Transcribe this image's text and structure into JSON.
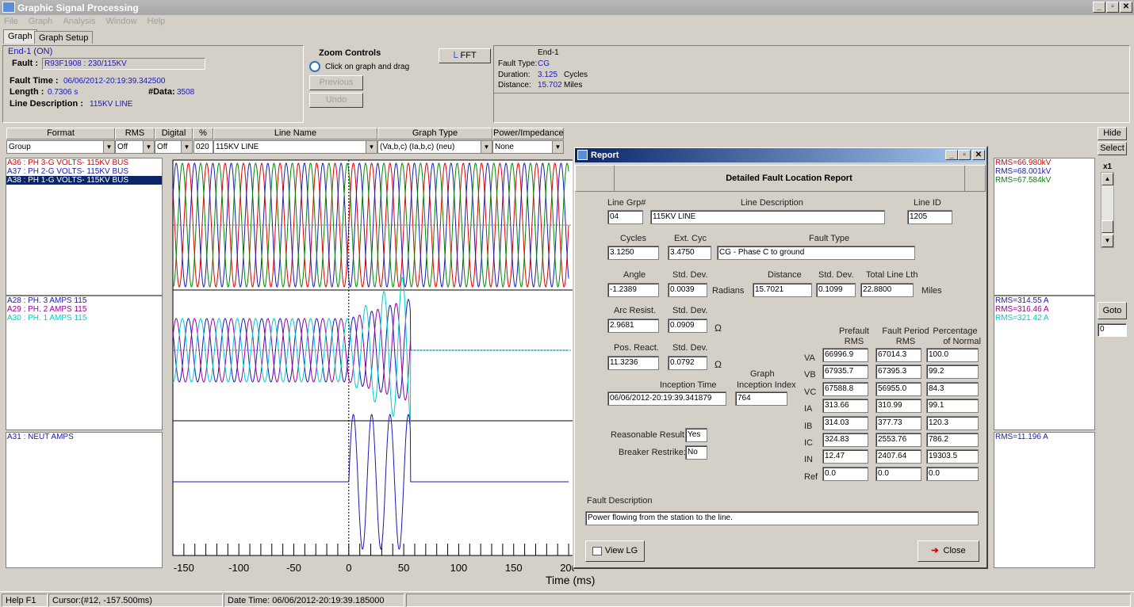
{
  "app": {
    "title": "Graphic Signal Processing",
    "window_buttons": [
      "_",
      "▫",
      "✕"
    ]
  },
  "menu": [
    "File",
    "Graph",
    "Analysis",
    "Window",
    "Help"
  ],
  "tabs": [
    "Graph",
    "Graph Setup"
  ],
  "info": {
    "end_label": "End-1 (ON)",
    "fault_label": "Fault :",
    "fault_value": "R93F1908 : 230/115KV",
    "fault_time_label": "Fault Time :",
    "fault_time_value": "06/06/2012-20:19:39.342500",
    "length_label": "Length :",
    "length_value": "0.7306 s",
    "ndata_label": "#Data:",
    "ndata_value": "3508",
    "line_desc_label": "Line Description :",
    "line_desc_value": "115KV LINE"
  },
  "zoom": {
    "title": "Zoom Controls",
    "hint": "Click on graph and drag",
    "previous": "Previous",
    "undo": "Undo",
    "fft": "FFT"
  },
  "fault_summary": {
    "end": "End-1",
    "type_label": "Fault Type:",
    "type_value": "CG",
    "duration_label": "Duration:",
    "duration_value": "3.125",
    "duration_unit": "Cycles",
    "distance_label": "Distance:",
    "distance_value": "15.702",
    "distance_unit": "Miles"
  },
  "toolbar": {
    "headers": [
      "Format",
      "RMS",
      "Digital",
      "%",
      "Line Name",
      "Graph Type",
      "Power/Impedance"
    ],
    "format": "Group",
    "rms": "Off",
    "digital": "Off",
    "pct": "020",
    "line_name": "115KV LINE",
    "graph_type": "(Va,b,c) (Ia,b,c) (neu)",
    "power": "None",
    "hide": "Hide",
    "select": "Select"
  },
  "channels": {
    "group1": [
      {
        "text": "A36 : PH 3-G VOLTS- 115KV BUS",
        "color": "#e00000"
      },
      {
        "text": "A37 : PH 2-G VOLTS- 115KV BUS",
        "color": "#1a1ab4"
      },
      {
        "text": "A38 : PH 1-G VOLTS- 115KV BUS",
        "color": "#ffffff"
      }
    ],
    "group2": [
      {
        "text": "A28 : PH. 3 AMPS 115",
        "color": "#1a1ab4"
      },
      {
        "text": "A29 : PH. 2 AMPS 115",
        "color": "#9a009a"
      },
      {
        "text": "A30 : PH. 1 AMPS 115",
        "color": "#00cccc"
      }
    ],
    "group3": [
      {
        "text": "A31 : NEUT AMPS",
        "color": "#1a1ab4"
      }
    ]
  },
  "rms": {
    "group1": [
      {
        "text": "RMS=66.980kV",
        "color": "#e00000"
      },
      {
        "text": "RMS=68.001kV",
        "color": "#1a1ab4"
      },
      {
        "text": "RMS=67.584kV",
        "color": "#008800"
      }
    ],
    "group2": [
      {
        "text": "RMS=314.55 A",
        "color": "#1a1ab4"
      },
      {
        "text": "RMS=316.46 A",
        "color": "#9a009a"
      },
      {
        "text": "RMS=321.42 A",
        "color": "#00cccc"
      }
    ],
    "group3": [
      {
        "text": "RMS=11.196 A",
        "color": "#1a1ab4"
      }
    ]
  },
  "zoomx": {
    "label": "x1",
    "goto": "Goto",
    "goto_value": "0"
  },
  "axis": {
    "xlabel": "Time (ms)",
    "ticks": [
      "-150",
      "-100",
      "-50",
      "0",
      "50",
      "100",
      "150",
      "200"
    ]
  },
  "chart_data": {
    "type": "line",
    "xlabel": "Time (ms)",
    "xlim": [
      -160,
      205
    ],
    "x_ticks": [
      -150,
      -100,
      -50,
      0,
      50,
      100,
      150,
      200
    ],
    "panels": [
      {
        "series": [
          "A36",
          "A37",
          "A38"
        ],
        "kind": "3-phase voltage, continuous sinusoid ~60Hz"
      },
      {
        "series": [
          "A28",
          "A29",
          "A30"
        ],
        "kind": "3-phase current, sinusoid until ~56 ms, then ~0; fault amplification from ~0 ms",
        "clear_ms": 56
      },
      {
        "series": [
          "A31"
        ],
        "kind": "neutral current, ~0 except fault window ~0 to 56 ms",
        "fault_start_ms": 0,
        "fault_end_ms": 56
      }
    ]
  },
  "report": {
    "title": "Report",
    "heading": "Detailed Fault Location Report",
    "line_grp_label": "Line Grp#",
    "line_grp": "04",
    "line_desc_label": "Line Description",
    "line_desc": "115KV LINE",
    "line_id_label": "Line ID",
    "line_id": "1205",
    "cycles_label": "Cycles",
    "cycles": "3.1250",
    "ext_cyc_label": "Ext. Cyc",
    "ext_cyc": "3.4750",
    "fault_type_label": "Fault Type",
    "fault_type": "CG - Phase C to ground",
    "angle_label": "Angle",
    "angle": "-1.2389",
    "angle_sd_label": "Std. Dev.",
    "angle_sd": "0.0039",
    "radians": "Radians",
    "distance_label": "Distance",
    "distance": "15.7021",
    "dist_sd_label": "Std. Dev.",
    "dist_sd": "0.1099",
    "total_len_label": "Total Line Lth",
    "total_len": "22.8800",
    "miles": "Miles",
    "arc_label": "Arc Resist.",
    "arc": "2.9681",
    "arc_sd_label": "Std. Dev.",
    "arc_sd": "0.0909",
    "ohm1": "Ω",
    "pos_label": "Pos. React.",
    "pos": "11.3236",
    "pos_sd_label": "Std. Dev.",
    "pos_sd": "0.0792",
    "ohm2": "Ω",
    "inception_label": "Inception Time",
    "inception": "06/06/2012-20:19:39.341879",
    "graph_idx_label1": "Graph",
    "graph_idx_label2": "Inception Index",
    "graph_idx": "764",
    "reasonable_label": "Reasonable Result:",
    "reasonable": "Yes",
    "breaker_label": "Breaker Restrike:",
    "breaker": "No",
    "col_prefault": [
      "Prefault",
      "RMS"
    ],
    "col_fault": [
      "Fault Period",
      "RMS"
    ],
    "col_pct": [
      "Percentage",
      "of Normal"
    ],
    "rows": [
      {
        "name": "VA",
        "pre": "66996.9",
        "fault": "67014.3",
        "pct": "100.0"
      },
      {
        "name": "VB",
        "pre": "67935.7",
        "fault": "67395.3",
        "pct": "99.2"
      },
      {
        "name": "VC",
        "pre": "67588.8",
        "fault": "56955.0",
        "pct": "84.3"
      },
      {
        "name": "IA",
        "pre": "313.66",
        "fault": "310.99",
        "pct": "99.1"
      },
      {
        "name": "IB",
        "pre": "314.03",
        "fault": "377.73",
        "pct": "120.3"
      },
      {
        "name": "IC",
        "pre": "324.83",
        "fault": "2553.76",
        "pct": "786.2"
      },
      {
        "name": "IN",
        "pre": "12.47",
        "fault": "2407.64",
        "pct": "19303.5"
      },
      {
        "name": "Ref",
        "pre": "0.0",
        "fault": "0.0",
        "pct": "0.0"
      }
    ],
    "fault_desc_label": "Fault Description",
    "fault_desc": "Power flowing from the station to the line.",
    "view_lg": "View LG",
    "close": "Close"
  },
  "status": {
    "help": "Help F1",
    "cursor": "Cursor:(#12, -157.500ms)",
    "datetime": "Date Time: 06/06/2012-20:19:39.185000"
  }
}
